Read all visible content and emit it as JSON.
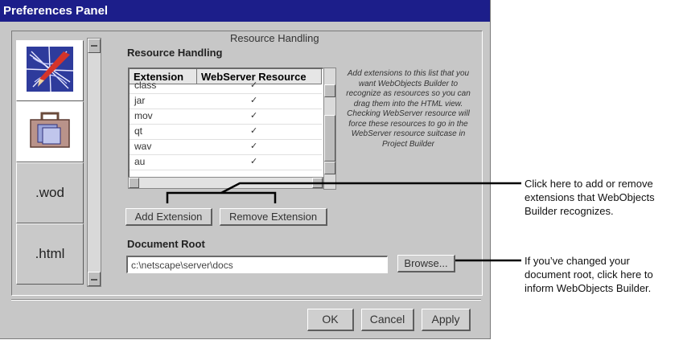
{
  "window": {
    "title": "Preferences Panel"
  },
  "tabs": [
    {
      "kind": "icon",
      "icon": "web-network-icon"
    },
    {
      "kind": "icon",
      "icon": "briefcase-icon",
      "selected": true
    },
    {
      "kind": "text",
      "label": ".wod"
    },
    {
      "kind": "text",
      "label": ".html"
    }
  ],
  "section": {
    "header": "Resource Handling",
    "group_title": "Resource Handling"
  },
  "table": {
    "columns": [
      "Extension",
      "WebServer Resource"
    ],
    "rows": [
      {
        "ext": "class",
        "checked": true
      },
      {
        "ext": "jar",
        "checked": true
      },
      {
        "ext": "mov",
        "checked": true
      },
      {
        "ext": "qt",
        "checked": true
      },
      {
        "ext": "wav",
        "checked": true
      },
      {
        "ext": "au",
        "checked": true
      }
    ],
    "check_glyph": "✓"
  },
  "help_text": "Add extensions to this list that you want WebObjects Builder to recognize as resources so you can drag them into the HTML view. Checking WebServer resource will force these resources to go in the WebServer resource suitcase in Project Builder",
  "buttons": {
    "add_extension": "Add Extension",
    "remove_extension": "Remove Extension",
    "browse": "Browse...",
    "ok": "OK",
    "cancel": "Cancel",
    "apply": "Apply"
  },
  "document_root": {
    "label": "Document Root",
    "value": "c:\\netscape\\server\\docs"
  },
  "callouts": {
    "extensions": "Click here to add or remove extensions that WebObjects Builder recognizes.",
    "document_root": "If you’ve changed your document root, click here to inform WebObjects Builder."
  },
  "colors": {
    "title_bar": "#1c1e8a",
    "panel": "#c7c7c7"
  }
}
